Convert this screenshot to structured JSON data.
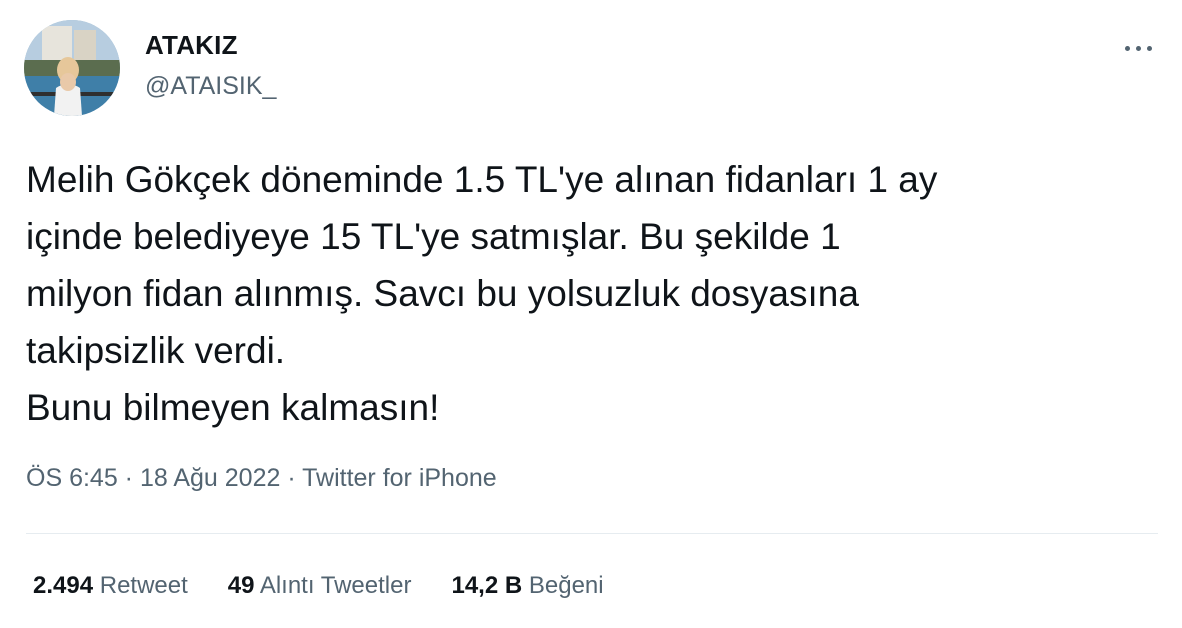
{
  "user": {
    "display_name": "ATAKIZ",
    "handle": "@ATAISIK_"
  },
  "tweet": {
    "text": "Melih Gökçek döneminde 1.5 TL'ye alınan fidanları 1 ay\niçinde belediyeye 15 TL'ye satmışlar. Bu şekilde 1\nmilyon fidan alınmış. Savcı bu yolsuzluk dosyasına\ntakipsizlik verdi.\nBunu bilmeyen kalmasın!"
  },
  "meta": {
    "time": "ÖS 6:45",
    "separator": " · ",
    "date": "18 Ağu 2022",
    "source": "Twitter for iPhone"
  },
  "stats": {
    "retweets_count": "2.494",
    "retweets_label": "Retweet",
    "quotes_count": "49",
    "quotes_label": "Alıntı Tweetler",
    "likes_count": "14,2 B",
    "likes_label": "Beğeni"
  },
  "icons": {
    "more": "more-horizontal-icon"
  },
  "colors": {
    "text": "#0f1419",
    "secondary": "#536471",
    "divider": "#e6ecf0"
  }
}
